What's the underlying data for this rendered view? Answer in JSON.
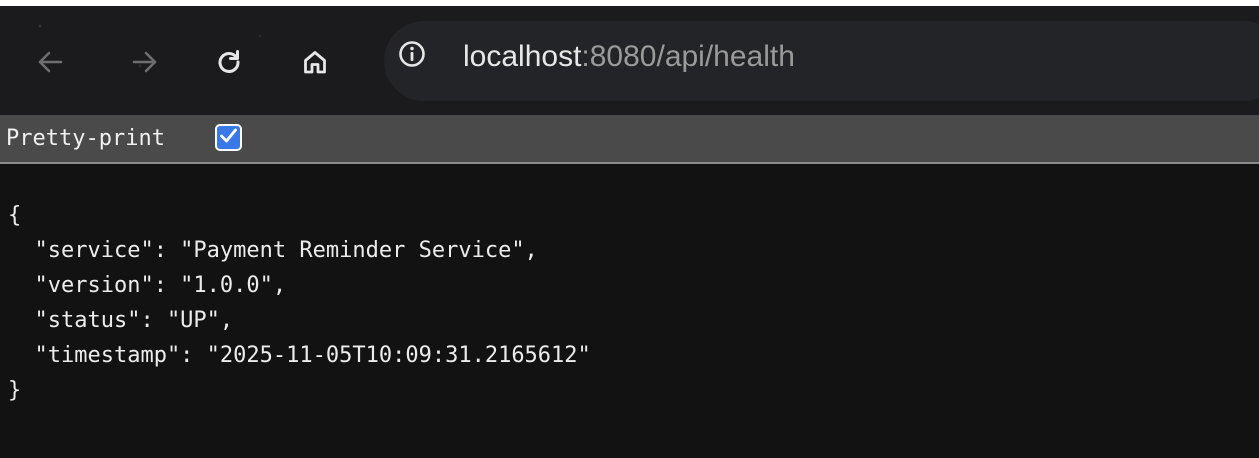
{
  "browser": {
    "back_icon": "arrow-left-icon",
    "forward_icon": "arrow-right-icon",
    "reload_icon": "reload-icon",
    "home_icon": "home-icon",
    "info_icon": "info-icon",
    "url_host": "localhost",
    "url_rest": ":8080/api/health"
  },
  "pretty_print": {
    "label": "Pretty-print",
    "checked": true
  },
  "json_lines": [
    "{",
    "  \"service\": \"Payment Reminder Service\",",
    "  \"version\": \"1.0.0\",",
    "  \"status\": \"UP\",",
    "  \"timestamp\": \"2025-11-05T10:09:31.2165612\"",
    "}"
  ]
}
